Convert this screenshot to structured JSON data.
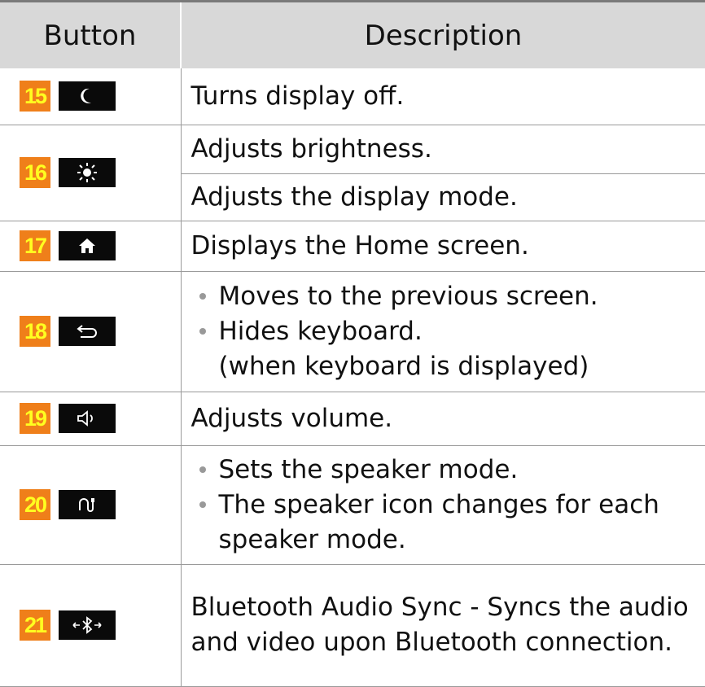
{
  "header": {
    "button_col": "Button",
    "description_col": "Description"
  },
  "rows": [
    {
      "number": "15",
      "icon": "moon-icon",
      "description": [
        "Turns display off."
      ]
    },
    {
      "number": "16",
      "icon": "sun-icon",
      "description": [
        "Adjusts brightness.",
        "Adjusts the display mode."
      ]
    },
    {
      "number": "17",
      "icon": "home-icon",
      "description": [
        "Displays the Home screen."
      ]
    },
    {
      "number": "18",
      "icon": "back-arrow-icon",
      "bullets": [
        "Moves to the previous screen.",
        "Hides keyboard."
      ],
      "note": "(when keyboard is displayed)"
    },
    {
      "number": "19",
      "icon": "volume-icon",
      "description": [
        "Adjusts volume."
      ]
    },
    {
      "number": "20",
      "icon": "speaker-mode-icon",
      "bullets": [
        "Sets the speaker mode.",
        "The speaker icon changes for each speaker mode."
      ]
    },
    {
      "number": "21",
      "icon": "bluetooth-sync-icon",
      "description": [
        "Bluetooth Audio Sync - Syncs the audio and video upon Bluetooth connection."
      ]
    }
  ],
  "colors": {
    "number_badge_bg": "#ef7f1a",
    "number_badge_text": "#ffff20",
    "header_bg": "#d8d8d8",
    "key_bg": "#0a0a0a"
  }
}
